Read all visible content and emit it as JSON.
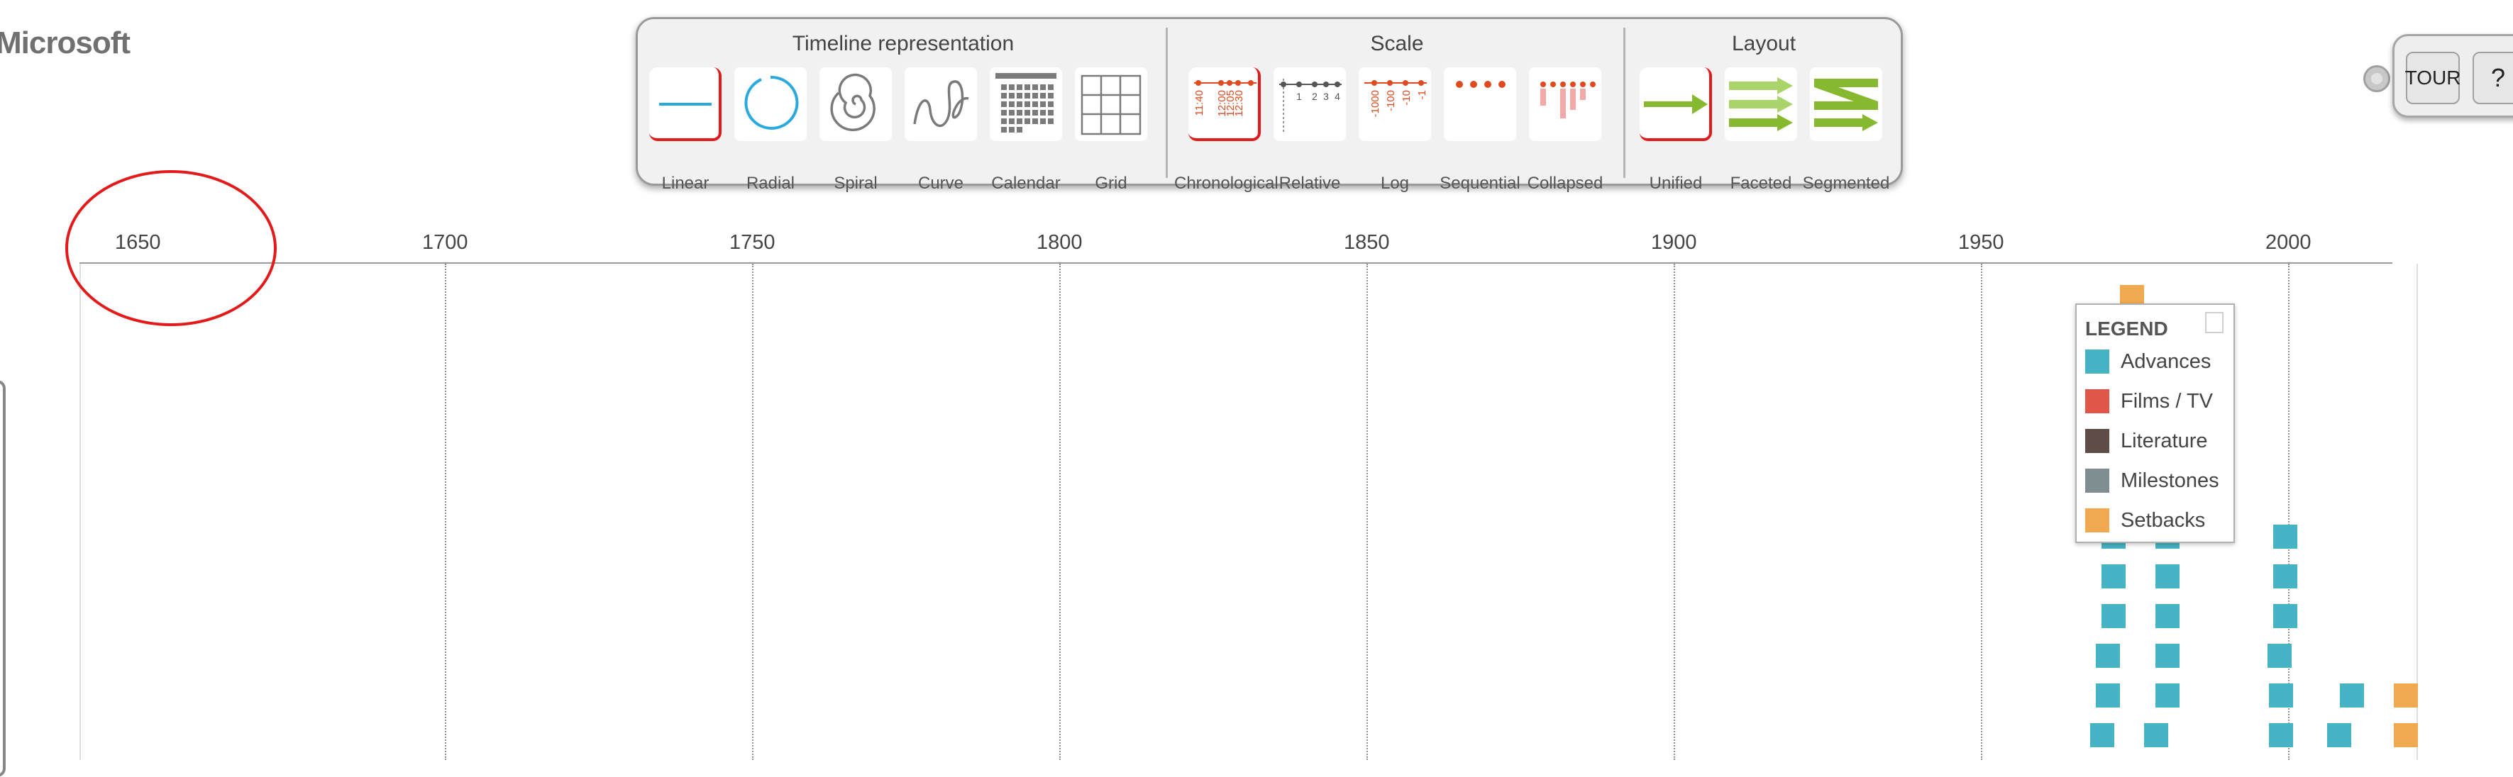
{
  "brand": "Microsoft",
  "toolbar": {
    "groups": [
      {
        "title": "Timeline representation",
        "items": [
          "Linear",
          "Radial",
          "Spiral",
          "Curve",
          "Calendar",
          "Grid"
        ]
      },
      {
        "title": "Scale",
        "items": [
          "Chronological",
          "Relative",
          "Log",
          "Sequential",
          "Collapsed"
        ]
      },
      {
        "title": "Layout",
        "items": [
          "Unified",
          "Faceted",
          "Segmented"
        ]
      }
    ],
    "selected": [
      "Linear",
      "Chronological",
      "Unified"
    ],
    "chronological_ticks": [
      "11:40",
      "12:00",
      "12:05",
      "12:30"
    ],
    "relative_ticks": [
      "1",
      "2",
      "3",
      "4"
    ],
    "log_ticks": [
      "-1000",
      "-100",
      "-10",
      "-1"
    ]
  },
  "tour": {
    "tour_label": "TOUR",
    "help_label": "?"
  },
  "axis": {
    "ticks": [
      "1650",
      "1700",
      "1750",
      "1800",
      "1850",
      "1900",
      "1950",
      "2000"
    ]
  },
  "legend": {
    "title": "LEGEND",
    "items": [
      {
        "label": "Advances",
        "color": "#45b3c4"
      },
      {
        "label": "Films / TV",
        "color": "#e0574a"
      },
      {
        "label": "Literature",
        "color": "#5e4d47"
      },
      {
        "label": "Milestones",
        "color": "#7f8e90"
      },
      {
        "label": "Setbacks",
        "color": "#f0a94e"
      }
    ]
  },
  "colors": {
    "accent": "#45b3c4",
    "selection": "#e21a1a",
    "scale_icon": "#e04a1e",
    "layout_icon": "#86b92f"
  }
}
